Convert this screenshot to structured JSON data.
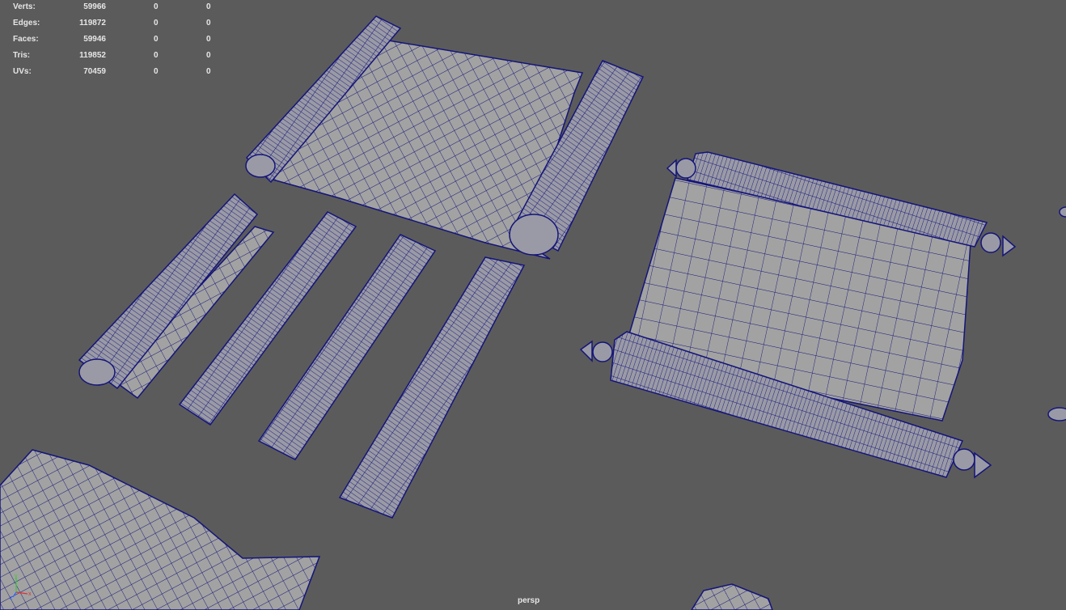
{
  "viewport": {
    "camera_label": "persp",
    "background": "#5b5b5b",
    "mesh_fill": "#a2a2a2",
    "wire_color": "#14147a"
  },
  "hud": {
    "rows": [
      {
        "label": "Verts:",
        "values": [
          "59966",
          "0",
          "0"
        ]
      },
      {
        "label": "Edges:",
        "values": [
          "119872",
          "0",
          "0"
        ]
      },
      {
        "label": "Faces:",
        "values": [
          "59946",
          "0",
          "0"
        ]
      },
      {
        "label": "Tris:",
        "values": [
          "119852",
          "0",
          "0"
        ]
      },
      {
        "label": "UVs:",
        "values": [
          "70459",
          "0",
          "0"
        ]
      }
    ]
  },
  "gizmo": {
    "x": "x",
    "y": "y",
    "z": "z"
  }
}
